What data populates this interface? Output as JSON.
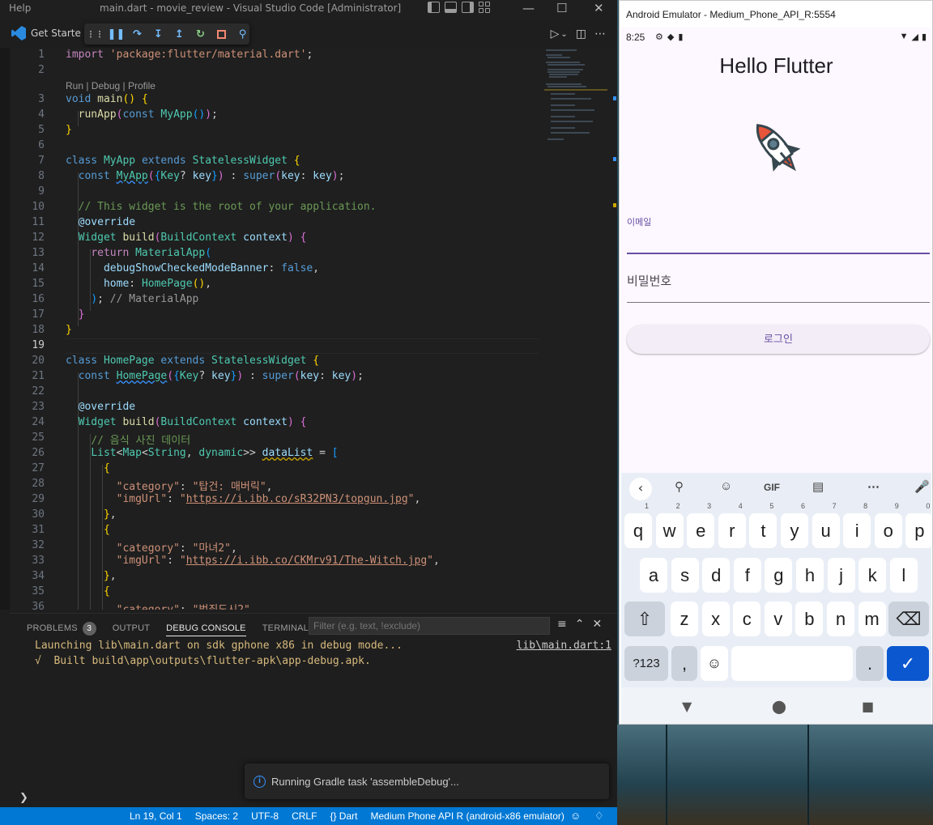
{
  "vscode": {
    "menu_help": "Help",
    "window_title": "main.dart - movie_review - Visual Studio Code [Administrator]",
    "tab_get_started": "Get Starte",
    "codelens": "Run | Debug | Profile",
    "panel": {
      "tabs": [
        "PROBLEMS",
        "OUTPUT",
        "DEBUG CONSOLE",
        "TERMINAL"
      ],
      "problems_count": "3",
      "filter_placeholder": "Filter (e.g. text, !exclude)",
      "console": [
        "Launching lib\\main.dart on sdk gphone x86 in debug mode...",
        "√  Built build\\app\\outputs\\flutter-apk\\app-debug.apk."
      ],
      "console_link": "lib\\main.dart:1"
    },
    "toast": "Running Gradle task 'assembleDebug'...",
    "status": {
      "position": "Ln 19, Col 1",
      "spaces": "Spaces: 2",
      "encoding": "UTF-8",
      "eol": "CRLF",
      "language": "{} Dart",
      "device": "Medium Phone API R (android-x86 emulator)"
    }
  },
  "emulator": {
    "window_title": "Android Emulator - Medium_Phone_API_R:5554",
    "status_time": "8:25",
    "app": {
      "title": "Hello Flutter",
      "email_label": "이메일",
      "password_label": "비밀번호",
      "login_button": "로그인"
    },
    "keyboard": {
      "toolbar_gif": "GIF",
      "row1": [
        "q",
        "w",
        "e",
        "r",
        "t",
        "y",
        "u",
        "i",
        "o",
        "p"
      ],
      "row1_hints": [
        "1",
        "2",
        "3",
        "4",
        "5",
        "6",
        "7",
        "8",
        "9",
        "0"
      ],
      "row2": [
        "a",
        "s",
        "d",
        "f",
        "g",
        "h",
        "j",
        "k",
        "l"
      ],
      "row3": [
        "z",
        "x",
        "c",
        "v",
        "b",
        "n",
        "m"
      ],
      "symbols_key": "?123",
      "comma_key": ",",
      "period_key": "."
    }
  }
}
